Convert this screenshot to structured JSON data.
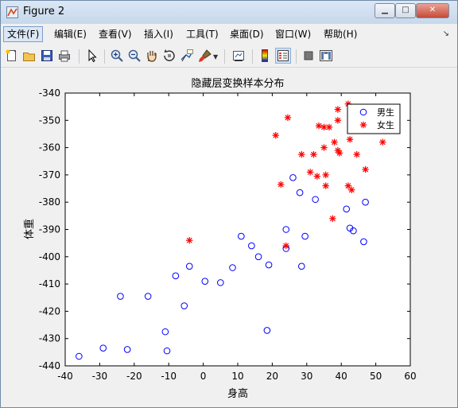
{
  "window": {
    "title": "Figure 2"
  },
  "menubar": {
    "items": [
      "文件(F)",
      "编辑(E)",
      "查看(V)",
      "插入(I)",
      "工具(T)",
      "桌面(D)",
      "窗口(W)",
      "帮助(H)"
    ]
  },
  "toolbar": {
    "icons": [
      "new-figure-icon",
      "open-file-icon",
      "save-icon",
      "print-icon",
      "pointer-icon",
      "zoom-in-icon",
      "zoom-out-icon",
      "pan-icon",
      "rotate-3d-icon",
      "data-cursor-icon",
      "brush-icon",
      "link-plot-icon",
      "colorbar-icon",
      "legend-icon",
      "hide-plot-tools-icon",
      "show-plot-tools-icon"
    ]
  },
  "colors": {
    "male": "#0000ff",
    "female": "#ff0000"
  },
  "chart_data": {
    "type": "scatter",
    "title": "隐藏层变换样本分布",
    "xlabel": "身高",
    "ylabel": "体重",
    "xlim": [
      -40,
      60
    ],
    "ylim": [
      -440,
      -340
    ],
    "xticks": [
      -40,
      -30,
      -20,
      -10,
      0,
      10,
      20,
      30,
      40,
      50,
      60
    ],
    "yticks": [
      -340,
      -350,
      -360,
      -370,
      -380,
      -390,
      -400,
      -410,
      -420,
      -430,
      -440
    ],
    "legend_position": "top-right",
    "grid": false,
    "series": [
      {
        "name": "男生",
        "marker": "o",
        "color": "#0000ff",
        "points": [
          [
            -36,
            -436.5
          ],
          [
            -29,
            -433.5
          ],
          [
            -22,
            -434
          ],
          [
            -24,
            -414.5
          ],
          [
            -16,
            -414.5
          ],
          [
            -11,
            -427.5
          ],
          [
            -10.5,
            -434.5
          ],
          [
            -8,
            -407
          ],
          [
            -5.5,
            -418
          ],
          [
            -4,
            -403.5
          ],
          [
            0.5,
            -409
          ],
          [
            5,
            -409.5
          ],
          [
            8.5,
            -404
          ],
          [
            11,
            -392.5
          ],
          [
            14,
            -396
          ],
          [
            16,
            -400
          ],
          [
            19,
            -403
          ],
          [
            18.5,
            -427
          ],
          [
            24,
            -397
          ],
          [
            24,
            -390
          ],
          [
            26,
            -371
          ],
          [
            28,
            -376.5
          ],
          [
            28.5,
            -403.5
          ],
          [
            29.5,
            -392.5
          ],
          [
            32.5,
            -379
          ],
          [
            41.5,
            -382.5
          ],
          [
            42.5,
            -389.5
          ],
          [
            43.5,
            -390.5
          ],
          [
            46.5,
            -394.5
          ],
          [
            47,
            -380
          ]
        ]
      },
      {
        "name": "女生",
        "marker": "*",
        "color": "#ff0000",
        "points": [
          [
            -4,
            -394
          ],
          [
            21,
            -355.5
          ],
          [
            22.5,
            -373.5
          ],
          [
            24,
            -396
          ],
          [
            24.5,
            -349
          ],
          [
            28.5,
            -362.5
          ],
          [
            31,
            -369
          ],
          [
            32,
            -362.5
          ],
          [
            33,
            -370.5
          ],
          [
            33.5,
            -352
          ],
          [
            35,
            -360
          ],
          [
            35,
            -352.5
          ],
          [
            35.5,
            -374
          ],
          [
            35.5,
            -370
          ],
          [
            36.5,
            -352.5
          ],
          [
            37.5,
            -386
          ],
          [
            38,
            -358
          ],
          [
            39,
            -346
          ],
          [
            39,
            -350
          ],
          [
            39,
            -361
          ],
          [
            39.5,
            -362
          ],
          [
            42,
            -344
          ],
          [
            42,
            -374
          ],
          [
            42.5,
            -357
          ],
          [
            43,
            -375.5
          ],
          [
            44.5,
            -362.5
          ],
          [
            47,
            -368
          ],
          [
            52,
            -358
          ]
        ]
      }
    ]
  }
}
